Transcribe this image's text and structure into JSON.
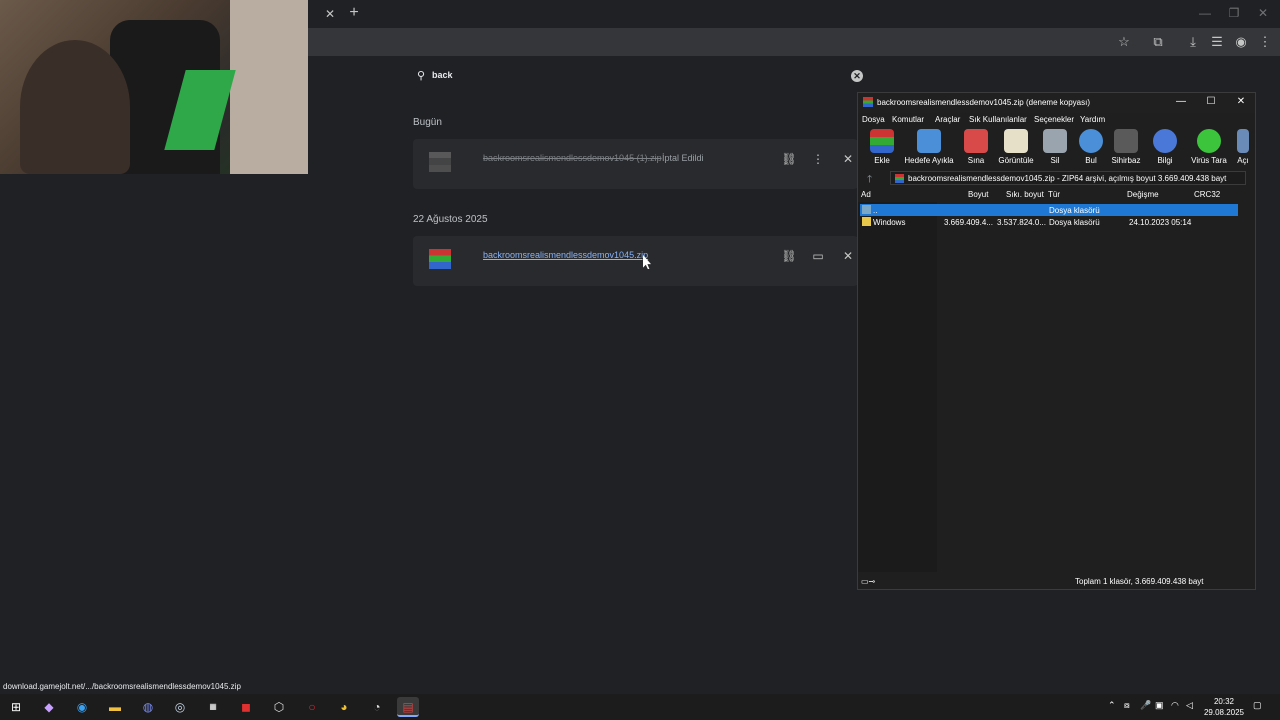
{
  "browser": {
    "search_query": "back"
  },
  "downloads": {
    "groups": [
      {
        "date": "Bugün",
        "item": {
          "filename": "backroomsrealismendlessdemov1045 (1).zip",
          "status": "İptal Edildi"
        }
      },
      {
        "date": "22 Ağustos 2025",
        "item": {
          "filename": "backroomsrealismendlessdemov1045.zip",
          "status": ""
        }
      }
    ]
  },
  "status_url": "download.gamejolt.net/.../backroomsrealismendlessdemov1045.zip",
  "winrar": {
    "title": "backroomsrealismendlessdemov1045.zip (deneme kopyası)",
    "menu": [
      "Dosya",
      "Komutlar",
      "Araçlar",
      "Sık Kullanılanlar",
      "Seçenekler",
      "Yardım"
    ],
    "tools": [
      "Ekle",
      "Hedefe Ayıkla",
      "Sına",
      "Görüntüle",
      "Sil",
      "Bul",
      "Sihirbaz",
      "Bilgi",
      "Virüs Tara",
      "Açı"
    ],
    "path": "backroomsrealismendlessdemov1045.zip - ZIP64 arşivi, açılmış boyut 3.669.409.438 bayt",
    "columns": [
      "Ad",
      "Boyut",
      "Sıkı. boyut",
      "Tür",
      "Değişme",
      "CRC32"
    ],
    "rows": [
      {
        "name": "..",
        "size": "",
        "packed": "",
        "type": "Dosya klasörü",
        "modified": ""
      },
      {
        "name": "Windows",
        "size": "3.669.409.4...",
        "packed": "3.537.824.0...",
        "type": "Dosya klasörü",
        "modified": "24.10.2023 05:14"
      }
    ],
    "status": "Toplam 1 klasör, 3.669.409.438 bayt"
  },
  "taskbar": {
    "time": "20:32",
    "date": "29.08.2025"
  },
  "icons": [
    "search-icon",
    "close-icon",
    "plus-icon",
    "star-icon",
    "extensions-icon",
    "download-icon",
    "profile-icon",
    "menu-icon",
    "link-icon",
    "more-icon",
    "folder-icon",
    "up-arrow-icon",
    "windows-start-icon"
  ],
  "colors": {
    "selection": "#1e78d4",
    "accent": "#88a8ff"
  }
}
